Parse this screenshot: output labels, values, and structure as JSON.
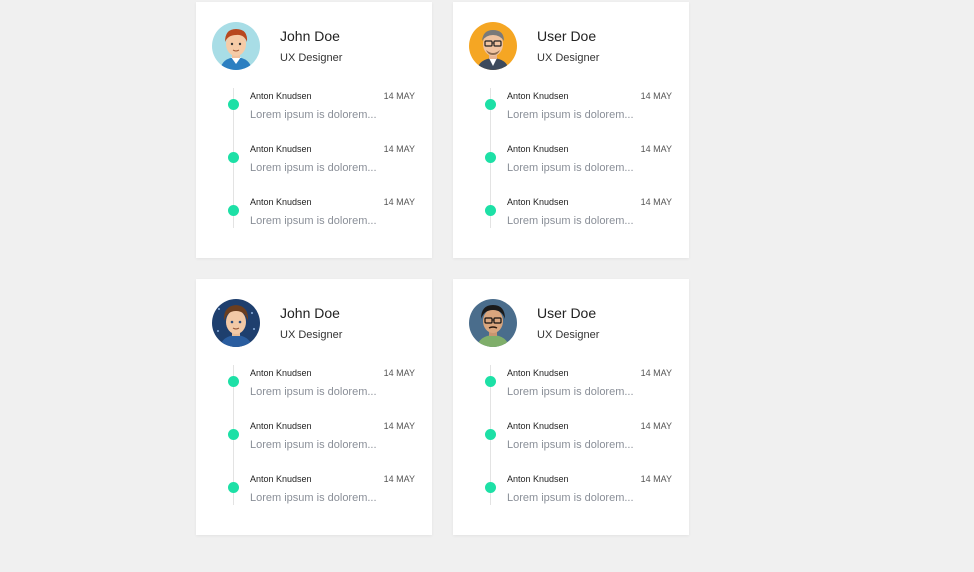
{
  "cards": [
    {
      "name": "John Doe",
      "role": "UX Designer",
      "avatar_icon": "avatar-redhead-man",
      "items": [
        {
          "author": "Anton Knudsen",
          "date": "14 MAY",
          "text": "Lorem ipsum is dolorem..."
        },
        {
          "author": "Anton Knudsen",
          "date": "14 MAY",
          "text": "Lorem ipsum is dolorem..."
        },
        {
          "author": "Anton Knudsen",
          "date": "14 MAY",
          "text": "Lorem ipsum is dolorem..."
        }
      ]
    },
    {
      "name": "User Doe",
      "role": "UX Designer",
      "avatar_icon": "avatar-glasses-man",
      "items": [
        {
          "author": "Anton Knudsen",
          "date": "14 MAY",
          "text": "Lorem ipsum is dolorem..."
        },
        {
          "author": "Anton Knudsen",
          "date": "14 MAY",
          "text": "Lorem ipsum is dolorem..."
        },
        {
          "author": "Anton Knudsen",
          "date": "14 MAY",
          "text": "Lorem ipsum is dolorem..."
        }
      ]
    },
    {
      "name": "John Doe",
      "role": "UX Designer",
      "avatar_icon": "avatar-brown-hair-man",
      "items": [
        {
          "author": "Anton Knudsen",
          "date": "14 MAY",
          "text": "Lorem ipsum is dolorem..."
        },
        {
          "author": "Anton Knudsen",
          "date": "14 MAY",
          "text": "Lorem ipsum is dolorem..."
        },
        {
          "author": "Anton Knudsen",
          "date": "14 MAY",
          "text": "Lorem ipsum is dolorem..."
        }
      ]
    },
    {
      "name": "User Doe",
      "role": "UX Designer",
      "avatar_icon": "avatar-dark-hair-glasses-man",
      "items": [
        {
          "author": "Anton Knudsen",
          "date": "14 MAY",
          "text": "Lorem ipsum is dolorem..."
        },
        {
          "author": "Anton Knudsen",
          "date": "14 MAY",
          "text": "Lorem ipsum is dolorem..."
        },
        {
          "author": "Anton Knudsen",
          "date": "14 MAY",
          "text": "Lorem ipsum is dolorem..."
        }
      ]
    }
  ],
  "colors": {
    "page_background": "#f0f0f0",
    "card_background": "#ffffff",
    "timeline_dot": "#1de0a6"
  }
}
